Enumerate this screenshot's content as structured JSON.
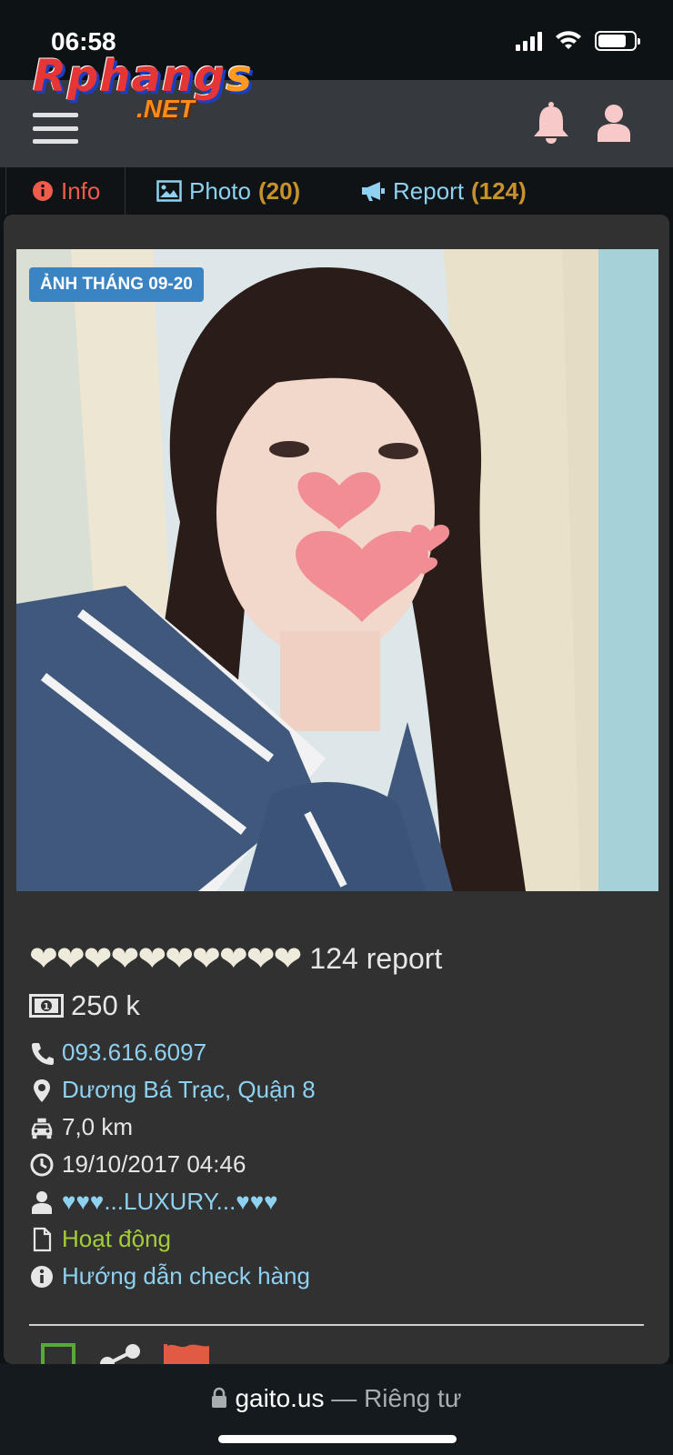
{
  "status_bar": {
    "time": "06:58"
  },
  "logo": {
    "word_a": "Rphang",
    "word_b": "s",
    "net": ".NET"
  },
  "tabs": [
    {
      "label": "Info"
    },
    {
      "label": "Photo",
      "count": "(20)"
    },
    {
      "label": "Report",
      "count": "(124)"
    }
  ],
  "profile": {
    "photo_badge": "ẢNH THÁNG 09-20",
    "hearts": "❤❤❤❤❤❤❤❤❤❤",
    "rating_level": 10,
    "report_count": "124 report",
    "price": "250 k",
    "phone": "093.616.6097",
    "address": "Dương Bá Trạc, Quận 8",
    "distance": "7,0 km",
    "date": "19/10/2017 04:46",
    "owner": "♥♥♥...LUXURY...♥♥♥",
    "status": "Hoạt động",
    "guide_link": "Hướng dẫn check hàng"
  },
  "browser": {
    "domain": "gaito.us",
    "separator": " — ",
    "private_label": "Riêng tư"
  },
  "colors": {
    "header_bg": "#363a3f",
    "card_bg": "#313131",
    "link": "#8fd1f0",
    "count": "#c8922a",
    "active_tab": "#ef5b4c",
    "status_green": "#a5cc3a",
    "badge_bg": "#3b84c4",
    "heart_color": "#efebdc",
    "icon_pink": "#f7c9c9"
  }
}
